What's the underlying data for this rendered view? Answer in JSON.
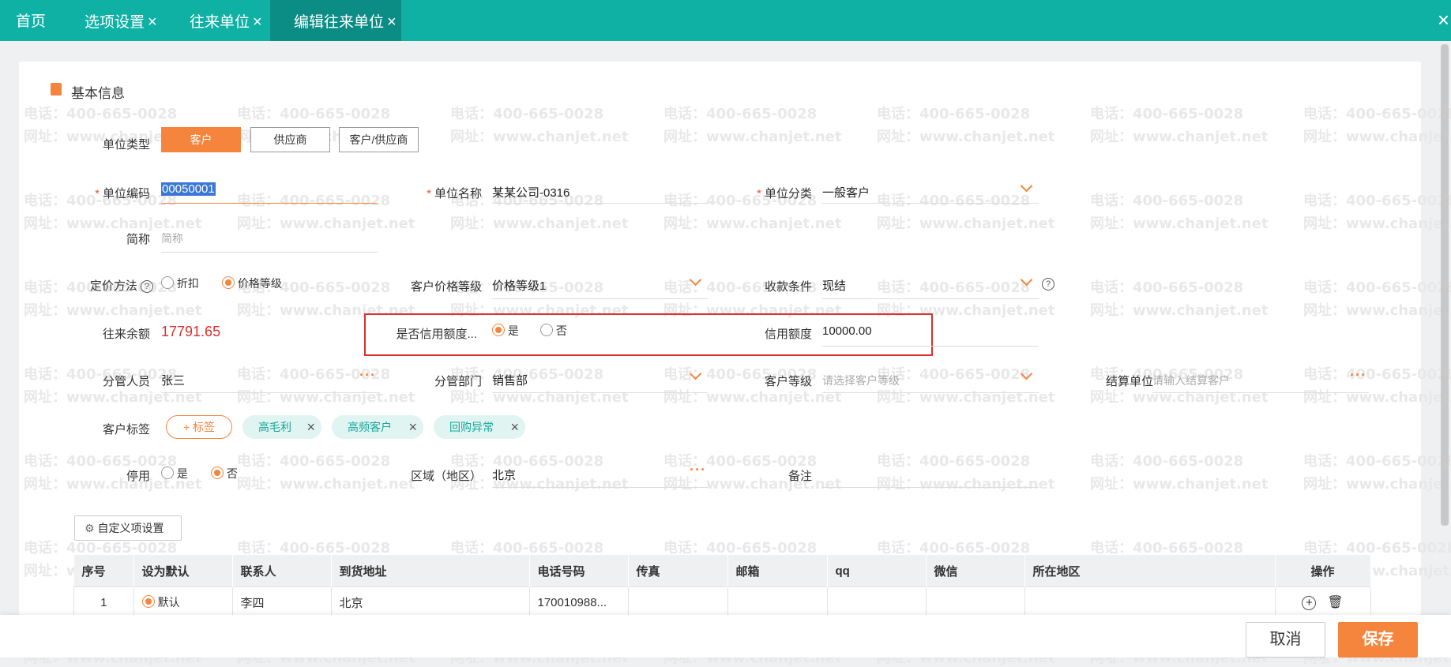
{
  "tabs": [
    {
      "label": "首页",
      "closable": false,
      "active": false
    },
    {
      "label": "选项设置",
      "closable": true,
      "active": false
    },
    {
      "label": "往来单位",
      "closable": true,
      "active": false
    },
    {
      "label": "编辑往来单位",
      "closable": true,
      "active": true
    }
  ],
  "watermark": {
    "phone": "电话：400-665-0028",
    "site": "网址：www.chanjet.net"
  },
  "section_title": "基本信息",
  "unit_type": {
    "label": "单位类型",
    "options": [
      "客户",
      "供应商",
      "客户/供应商"
    ],
    "selected": "客户"
  },
  "unit_code": {
    "label": "单位编码",
    "value": "00050001"
  },
  "unit_name": {
    "label": "单位名称",
    "value": "某某公司-0316"
  },
  "unit_category": {
    "label": "单位分类",
    "value": "一般客户"
  },
  "short_name": {
    "label": "简称",
    "placeholder": "简称"
  },
  "pricing": {
    "label": "定价方法",
    "options": [
      "折扣",
      "价格等级"
    ],
    "selected": "价格等级"
  },
  "price_level": {
    "label": "客户价格等级",
    "value": "价格等级1"
  },
  "payment_terms": {
    "label": "收款条件",
    "value": "现结"
  },
  "balance": {
    "label": "往来余额",
    "value": "17791.65"
  },
  "credit_enabled": {
    "label": "是否信用额度...",
    "options": [
      "是",
      "否"
    ],
    "selected": "是"
  },
  "credit_limit": {
    "label": "信用额度",
    "value": "10000.00"
  },
  "manager": {
    "label": "分管人员",
    "value": "张三"
  },
  "department": {
    "label": "分管部门",
    "value": "销售部"
  },
  "customer_level": {
    "label": "客户等级",
    "placeholder": "请选择客户等级"
  },
  "settlement": {
    "label": "结算单位",
    "placeholder": "请输入结算客户"
  },
  "tags": {
    "label": "客户标签",
    "add_label": "+ 标签",
    "items": [
      "高毛利",
      "高频客户",
      "回购异常"
    ]
  },
  "disabled": {
    "label": "停用",
    "options": [
      "是",
      "否"
    ],
    "selected": "否"
  },
  "region": {
    "label": "区域（地区）",
    "value": "北京"
  },
  "remark": {
    "label": "备注",
    "value": ""
  },
  "custom_settings": "自定义项设置",
  "table": {
    "headers": [
      "序号",
      "设为默认",
      "联系人",
      "到货地址",
      "电话号码",
      "传真",
      "邮箱",
      "qq",
      "微信",
      "所在地区",
      "操作"
    ],
    "rows": [
      {
        "index": "1",
        "default": "默认",
        "contact": "李四",
        "address": "北京",
        "phone": "170010988...",
        "fax": "",
        "email": "",
        "qq": "",
        "wechat": "",
        "region": ""
      }
    ]
  },
  "footer": {
    "cancel": "取消",
    "save": "保存"
  },
  "colors": {
    "brand": "#0fb1a5",
    "accent": "#f5843c",
    "highlight_box": "#d9302c"
  }
}
